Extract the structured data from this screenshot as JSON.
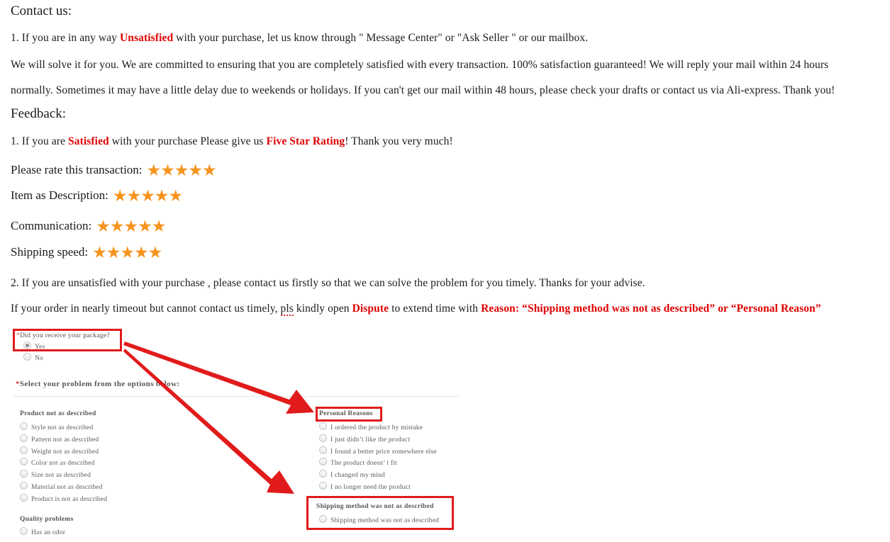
{
  "document": {
    "contact_heading": "Contact us:",
    "paragraph_1_pre": "1.  If you are in any way ",
    "paragraph_1_red": "Unsatisfied",
    "paragraph_1_post": " with your purchase, let us know through \" Message Center\" or \"Ask Seller \" or our mailbox.",
    "paragraph_2": "We will solve it for you. We are committed to ensuring that you are completely satisfied with every transaction. 100% satisfaction guaranteed!    We will reply your mail within 24 hours",
    "paragraph_3": "normally. Sometimes it may have a little delay due to weekends or holidays. If you can't get our mail within 48 hours, please check your drafts or contact us via Ali-express. Thank you!",
    "feedback_heading": "Feedback:",
    "paragraph_4_pre": "1.  If you are ",
    "paragraph_4_red1": "Satisfied",
    "paragraph_4_mid": " with your purchase Please give us ",
    "paragraph_4_red2": "Five Star Rating",
    "paragraph_4_post": "! Thank you very much!",
    "paragraph_5": "2.  If you are unsatisfied with your purchase , please contact us firstly so that we can solve the problem  for you timely. Thanks for your advise.",
    "paragraph_6_pre": "If your order in nearly timeout but cannot contact us timely, ",
    "paragraph_6_spell": "pls",
    "paragraph_6_mid1": " kindly open ",
    "paragraph_6_red1": "Dispute",
    "paragraph_6_mid2": " to extend time with ",
    "paragraph_6_red2": "Reason: “Shipping method was not as described” or “Personal Reason”"
  },
  "ratings": {
    "star_glyph": "★★★★★",
    "star_color": "#f7941e",
    "rows": [
      {
        "label": "Please rate this transaction:",
        "stars": 5
      },
      {
        "label": "Item as Description:",
        "stars": 5
      },
      {
        "label": "Communication:",
        "stars": 5
      },
      {
        "label": "Shipping speed:",
        "stars": 5
      }
    ]
  },
  "form": {
    "question_asterisk": "*",
    "question_label": "Did you receive your package?",
    "yes_label": "Yes",
    "no_label": "No",
    "yes_selected": true,
    "select_prompt_asterisk": "*",
    "select_prompt": "Select your problem from the options below:",
    "left_groups": [
      {
        "title": "Product not as described",
        "options": [
          "Style not as described",
          "Pattern not as described",
          "Weight not as described",
          "Color not as described",
          "Size not as described",
          "Material not as described",
          "Product is not as described"
        ]
      },
      {
        "title": "Quality problems",
        "options": [
          "Has an odor"
        ]
      }
    ],
    "right_groups": [
      {
        "title": "Personal Reasons",
        "options": [
          "I ordered the product by mistake",
          "I just didn’t like the product",
          "I found a better price somewhere else",
          "The product doesn’ t fit",
          "I changed my mind",
          "I no longer need the product"
        ]
      },
      {
        "title": "Shipping method was not as described",
        "options": [
          "Shipping method was not as described"
        ]
      }
    ]
  },
  "annotations": {
    "highlight_color": "#e11b1b",
    "boxes": [
      "did-you-receive-your-package",
      "personal-reasons",
      "shipping-method-was-not-as-described"
    ],
    "arrows": 2
  }
}
